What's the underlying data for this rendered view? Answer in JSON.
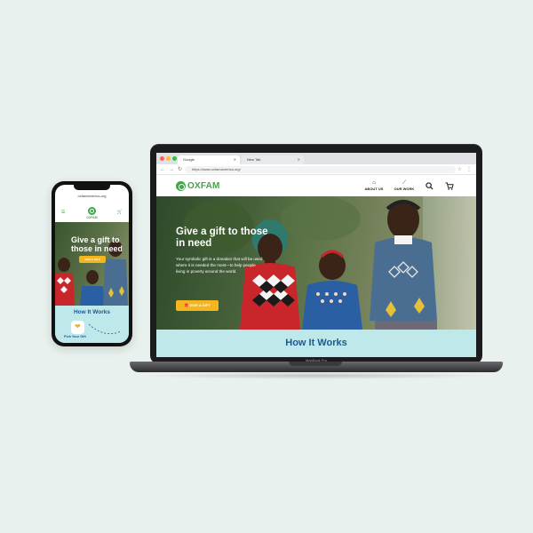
{
  "laptop": {
    "model_label": "MacBook Pro",
    "browser": {
      "tabs": [
        {
          "label": "Google"
        },
        {
          "label": "New Tab"
        }
      ],
      "url": "https://www.oxfamamerica.org/"
    },
    "site": {
      "logo_text": "OXFAM",
      "nav": [
        {
          "label": "ABOUT US",
          "icon": "home-icon"
        },
        {
          "label": "OUR WORK",
          "icon": "wand-icon"
        }
      ],
      "hero": {
        "title": "Give a gift to those in need",
        "body": "Your symbolic gift is a donation that will be used where it is needed the most—to help people living in poverty around the world.",
        "cta_label": "GIVE A GIFT"
      },
      "how_it_works_title": "How It Works"
    }
  },
  "phone": {
    "url": "oxfamamerica.org",
    "logo_text": "OXFAM",
    "hero": {
      "title": "Give a gift to those in need",
      "cta_label": "GIVE A GIFT"
    },
    "how_it_works_title": "How It Works",
    "step_label": "Pick Your Gift"
  },
  "colors": {
    "brand_green": "#44a548",
    "cta_yellow": "#f5b51f",
    "section_blue": "#bfe8ea",
    "heading_blue": "#1b5a8f",
    "background": "#e9f1ee"
  }
}
